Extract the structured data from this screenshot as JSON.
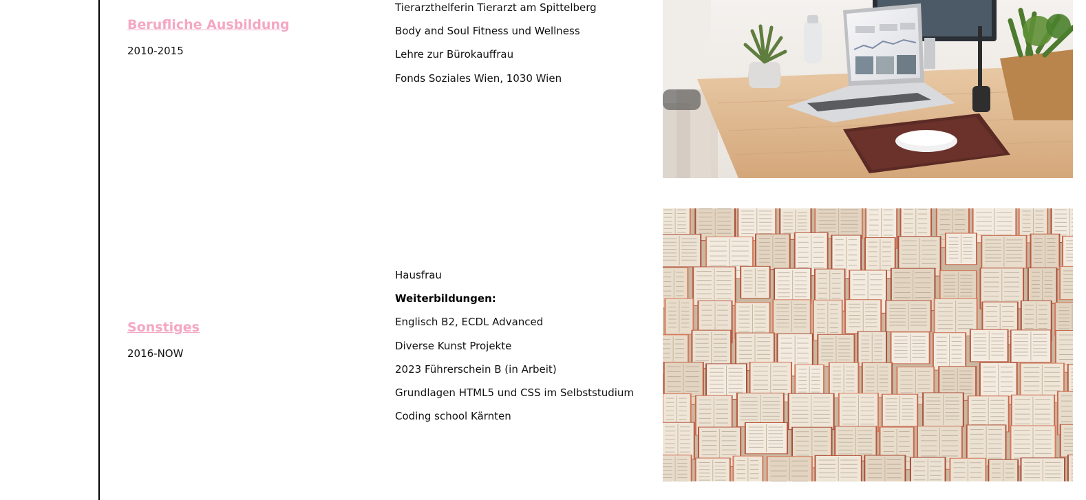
{
  "sections": [
    {
      "title": "Berufliche Ausbildung",
      "years": "2010-2015",
      "items": [
        {
          "text": "Tierarzthelferin Tierarzt am Spittelberg",
          "bold": false
        },
        {
          "text": "Body and Soul Fitness und Wellness",
          "bold": false
        },
        {
          "text": "Lehre zur Bürokauffrau",
          "bold": false
        },
        {
          "text": "Fonds Soziales Wien, 1030 Wien",
          "bold": false
        }
      ],
      "image": "desk-laptop-photo"
    },
    {
      "title": "Sonstiges",
      "years": "2016-NOW",
      "items": [
        {
          "text": "Hausfrau",
          "bold": false
        },
        {
          "text": "Weiterbildungen:",
          "bold": true
        },
        {
          "text": "Englisch B2, ECDL Advanced",
          "bold": false
        },
        {
          "text": "Diverse Kunst Projekte",
          "bold": false
        },
        {
          "text": "2023 Führerschein B (in Arbeit)",
          "bold": false
        },
        {
          "text": "Grundlagen HTML5 und CSS im Selbststudium",
          "bold": false
        },
        {
          "text": "Coding school Kärnten",
          "bold": false
        }
      ],
      "image": "open-books-wall-photo"
    }
  ],
  "colors": {
    "accent": "#f4a7c3",
    "rule": "#000000"
  }
}
